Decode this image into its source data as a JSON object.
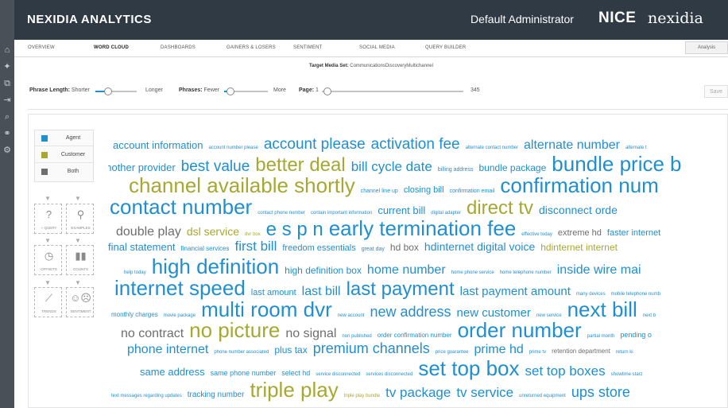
{
  "app": {
    "brand": "NEXIDIA ANALYTICS",
    "user": "Default Administrator",
    "logo_nice": "NICE",
    "logo_nexidia": "nexidia"
  },
  "rail_icons": [
    "home-icon",
    "lightbulb-icon",
    "network-icon",
    "export-icon",
    "search-icon",
    "share-icon",
    "settings-icon"
  ],
  "tabs": [
    {
      "label": "OVERVIEW",
      "active": false
    },
    {
      "label": "WORD CLOUD",
      "active": true
    },
    {
      "label": "DASHBOARDS",
      "active": false
    },
    {
      "label": "GAINERS & LOSERS",
      "active": false
    },
    {
      "label": "SENTIMENT",
      "active": false
    },
    {
      "label": "SOCIAL MEDIA",
      "active": false
    },
    {
      "label": "QUERY BUILDER",
      "active": false
    }
  ],
  "analysis_label": "Analysis",
  "target": {
    "label": "Target Media Set:",
    "value": "CommunicationsDiscoveryMultichannel"
  },
  "controls": {
    "phrase_length_label": "Phrase Length:",
    "shorter": "Shorter",
    "longer": "Longer",
    "phrase_length_level": 0.3,
    "phrases_label": "Phrases:",
    "fewer": "Fewer",
    "more": "More",
    "phrases_level": 0.15,
    "page_label": "Page:",
    "page_current": "1",
    "page_total": "345",
    "page_level": 0.0,
    "save_label": "Save"
  },
  "legend": [
    {
      "label": "Agent",
      "color": "#1f8fd0"
    },
    {
      "label": "Customer",
      "color": "#a6a832"
    },
    {
      "label": "Both",
      "color": "#6e6e6e"
    }
  ],
  "tools": [
    {
      "label": "+ QUERY",
      "icon": "question-icon"
    },
    {
      "label": "EXAMPLES",
      "icon": "magnify-icon"
    },
    {
      "label": "OFFSETS",
      "icon": "clock-icon"
    },
    {
      "label": "COUNTS",
      "icon": "bar-chart-icon"
    },
    {
      "label": "TRENDS",
      "icon": "line-chart-icon"
    },
    {
      "label": "SENTIMENT",
      "icon": "faces-icon"
    }
  ],
  "colors": {
    "agent": "#1f8fd0",
    "customer": "#a6a832",
    "both": "#6e6e6e"
  },
  "cloud_lines": [
    [
      {
        "t": "account information",
        "s": 13,
        "c": "agent"
      },
      {
        "t": "account number please",
        "s": 6,
        "c": "agent"
      },
      {
        "t": "account please",
        "s": 19,
        "c": "agent"
      },
      {
        "t": "activation fee",
        "s": 19,
        "c": "agent"
      },
      {
        "t": "alternate contact number",
        "s": 6,
        "c": "agent"
      },
      {
        "t": "alternate number",
        "s": 16,
        "c": "agent"
      },
      {
        "t": "alternate t",
        "s": 6,
        "c": "agent"
      }
    ],
    [
      {
        "t": "another provider",
        "s": 13,
        "c": "agent"
      },
      {
        "t": "best value",
        "s": 19,
        "c": "agent"
      },
      {
        "t": "better deal",
        "s": 24,
        "c": "customer"
      },
      {
        "t": "bill cycle date",
        "s": 17,
        "c": "agent"
      },
      {
        "t": "billing address",
        "s": 7,
        "c": "agent"
      },
      {
        "t": "bundle package",
        "s": 12,
        "c": "agent"
      },
      {
        "t": "bundle price",
        "s": 26,
        "c": "agent"
      },
      {
        "t": "b",
        "s": 26,
        "c": "agent"
      }
    ],
    [
      {
        "t": "channel available shortly",
        "s": 26,
        "c": "customer"
      },
      {
        "t": "channel line up",
        "s": 7,
        "c": "agent"
      },
      {
        "t": "closing bill",
        "s": 11,
        "c": "agent"
      },
      {
        "t": "confirmation email",
        "s": 7,
        "c": "agent"
      },
      {
        "t": "confirmation num",
        "s": 26,
        "c": "agent"
      }
    ],
    [
      {
        "t": "contact number",
        "s": 26,
        "c": "agent"
      },
      {
        "t": "contact phone number",
        "s": 6,
        "c": "agent"
      },
      {
        "t": "contain important information",
        "s": 6,
        "c": "agent"
      },
      {
        "t": "current bill",
        "s": 13,
        "c": "agent"
      },
      {
        "t": "digital adapter",
        "s": 6,
        "c": "agent"
      },
      {
        "t": "direct tv",
        "s": 24,
        "c": "customer"
      },
      {
        "t": "disconnect orde",
        "s": 14,
        "c": "agent"
      }
    ],
    [
      {
        "t": "double play",
        "s": 16,
        "c": "both"
      },
      {
        "t": "dsl service",
        "s": 14,
        "c": "customer"
      },
      {
        "t": "dvr box",
        "s": 6,
        "c": "customer"
      },
      {
        "t": "e s p n",
        "s": 24,
        "c": "agent"
      },
      {
        "t": "early termination fee",
        "s": 26,
        "c": "agent"
      },
      {
        "t": "effective today",
        "s": 6,
        "c": "agent"
      },
      {
        "t": "extreme hd",
        "s": 11,
        "c": "both"
      },
      {
        "t": "faster internet",
        "s": 11,
        "c": "agent"
      }
    ],
    [
      {
        "t": "final statement",
        "s": 13,
        "c": "agent"
      },
      {
        "t": "financial services",
        "s": 8,
        "c": "agent"
      },
      {
        "t": "first bill",
        "s": 17,
        "c": "agent"
      },
      {
        "t": "freedom essentials",
        "s": 11,
        "c": "agent"
      },
      {
        "t": "great day",
        "s": 7,
        "c": "agent"
      },
      {
        "t": "hd box",
        "s": 12,
        "c": "both"
      },
      {
        "t": "hdinternet digital voice",
        "s": 14,
        "c": "agent"
      },
      {
        "t": "hdinternet internet",
        "s": 12,
        "c": "customer"
      }
    ],
    [
      {
        "t": "help today",
        "s": 6,
        "c": "agent"
      },
      {
        "t": "high definition",
        "s": 26,
        "c": "agent"
      },
      {
        "t": "high definition box",
        "s": 12,
        "c": "agent"
      },
      {
        "t": "home number",
        "s": 16,
        "c": "agent"
      },
      {
        "t": "home phone service",
        "s": 6,
        "c": "agent"
      },
      {
        "t": "home telephone number",
        "s": 6,
        "c": "agent"
      },
      {
        "t": "inside wire mai",
        "s": 16,
        "c": "agent"
      }
    ],
    [
      {
        "t": "internet speed",
        "s": 26,
        "c": "agent"
      },
      {
        "t": "last amount",
        "s": 11,
        "c": "agent"
      },
      {
        "t": "last bill",
        "s": 16,
        "c": "agent"
      },
      {
        "t": "last payment",
        "s": 24,
        "c": "agent"
      },
      {
        "t": "last payment amount",
        "s": 15,
        "c": "agent"
      },
      {
        "t": "many devices",
        "s": 6,
        "c": "agent"
      },
      {
        "t": "mobile telephone numb",
        "s": 6,
        "c": "agent"
      }
    ],
    [
      {
        "t": "monthly charges",
        "s": 8,
        "c": "agent"
      },
      {
        "t": "movie package",
        "s": 6,
        "c": "agent"
      },
      {
        "t": "multi room dvr",
        "s": 26,
        "c": "agent"
      },
      {
        "t": "new account",
        "s": 6,
        "c": "agent"
      },
      {
        "t": "new address",
        "s": 18,
        "c": "agent"
      },
      {
        "t": "new customer",
        "s": 15,
        "c": "agent"
      },
      {
        "t": "new service",
        "s": 6,
        "c": "agent"
      },
      {
        "t": "next bill",
        "s": 26,
        "c": "agent"
      },
      {
        "t": "next b",
        "s": 6,
        "c": "agent"
      }
    ],
    [
      {
        "t": "no contract",
        "s": 16,
        "c": "both"
      },
      {
        "t": "no picture",
        "s": 26,
        "c": "customer"
      },
      {
        "t": "no signal",
        "s": 16,
        "c": "both"
      },
      {
        "t": "non published",
        "s": 6,
        "c": "agent"
      },
      {
        "t": "order confirmation number",
        "s": 8,
        "c": "agent"
      },
      {
        "t": "order number",
        "s": 26,
        "c": "agent"
      },
      {
        "t": "partial month",
        "s": 6,
        "c": "agent"
      },
      {
        "t": "pending o",
        "s": 9,
        "c": "agent"
      }
    ],
    [
      {
        "t": "phone internet",
        "s": 16,
        "c": "agent"
      },
      {
        "t": "phone number associated",
        "s": 6,
        "c": "agent"
      },
      {
        "t": "plus tax",
        "s": 12,
        "c": "agent"
      },
      {
        "t": "premium channels",
        "s": 18,
        "c": "agent"
      },
      {
        "t": "price guarantee",
        "s": 6,
        "c": "agent"
      },
      {
        "t": "prime hd",
        "s": 16,
        "c": "agent"
      },
      {
        "t": "prime tv",
        "s": 6,
        "c": "agent"
      },
      {
        "t": "retention department",
        "s": 8,
        "c": "both"
      },
      {
        "t": "return ki",
        "s": 6,
        "c": "agent"
      }
    ],
    [
      {
        "t": "same address",
        "s": 13,
        "c": "agent"
      },
      {
        "t": "same phone number",
        "s": 9,
        "c": "agent"
      },
      {
        "t": "select hd",
        "s": 9,
        "c": "agent"
      },
      {
        "t": "service disconnected",
        "s": 6,
        "c": "agent"
      },
      {
        "t": "services disconnected",
        "s": 6,
        "c": "agent"
      },
      {
        "t": "set top box",
        "s": 26,
        "c": "agent"
      },
      {
        "t": "set top boxes",
        "s": 17,
        "c": "agent"
      },
      {
        "t": "showtime starz",
        "s": 6,
        "c": "agent"
      }
    ],
    [
      {
        "t": "text messages regarding updates",
        "s": 6,
        "c": "agent"
      },
      {
        "t": "tracking number",
        "s": 10,
        "c": "agent"
      },
      {
        "t": "triple play",
        "s": 26,
        "c": "customer"
      },
      {
        "t": "triple play bundle",
        "s": 6,
        "c": "customer"
      },
      {
        "t": "tv package",
        "s": 17,
        "c": "agent"
      },
      {
        "t": "tv service",
        "s": 17,
        "c": "agent"
      },
      {
        "t": "unreturned equipment",
        "s": 6,
        "c": "agent"
      },
      {
        "t": "ups store",
        "s": 18,
        "c": "agent"
      }
    ]
  ]
}
